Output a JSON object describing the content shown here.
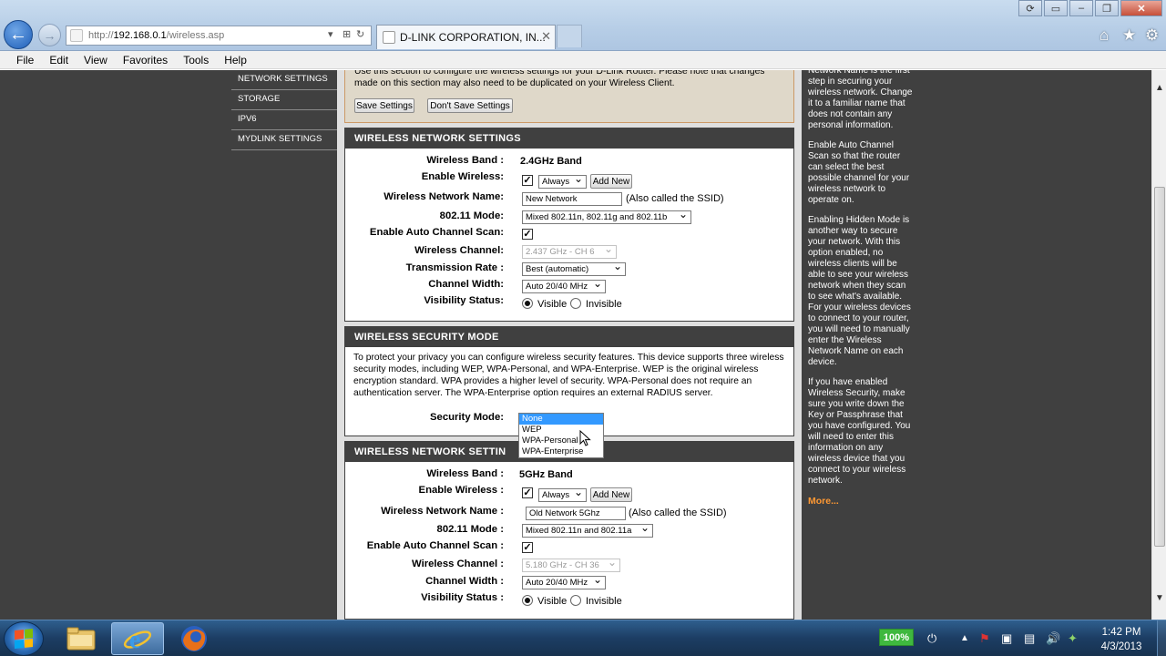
{
  "browser": {
    "url_scheme": "http://",
    "url_host": "192.168.0.1",
    "url_path": "/wireless.asp",
    "tab_title": "D-LINK CORPORATION, IN...",
    "menu": [
      "File",
      "Edit",
      "View",
      "Favorites",
      "Tools",
      "Help"
    ]
  },
  "leftnav": {
    "items": [
      "NETWORK SETTINGS",
      "STORAGE",
      "IPV6",
      "MYDLINK SETTINGS"
    ]
  },
  "intro": {
    "text": "Use this section to configure the wireless settings for your D-Link Router. Please note that changes made on this section may also need to be duplicated on your Wireless Client.",
    "save_label": "Save Settings",
    "dont_save_label": "Don't Save Settings"
  },
  "wns1": {
    "heading": "WIRELESS NETWORK SETTINGS",
    "band_label": "Wireless Band :",
    "band_value": "2.4GHz Band",
    "enable_label": "Enable Wireless:",
    "enable_checked": true,
    "schedule_value": "Always",
    "add_new_label": "Add New",
    "name_label": "Wireless Network Name:",
    "name_value": "New Network",
    "ssid_hint": "(Also called the SSID)",
    "mode_label": "802.11 Mode:",
    "mode_value": "Mixed 802.11n, 802.11g and 802.11b",
    "auto_scan_label": "Enable Auto Channel Scan:",
    "auto_scan_checked": true,
    "channel_label": "Wireless Channel:",
    "channel_value": "2.437 GHz - CH 6",
    "rate_label": "Transmission Rate :",
    "rate_value": "Best (automatic)",
    "width_label": "Channel Width:",
    "width_value": "Auto 20/40 MHz",
    "visibility_label": "Visibility Status:",
    "visible_label": "Visible",
    "invisible_label": "Invisible",
    "visibility_selected": "Visible"
  },
  "security": {
    "heading": "WIRELESS SECURITY MODE",
    "description": "To protect your privacy you can configure wireless security features. This device supports three wireless security modes, including WEP, WPA-Personal, and WPA-Enterprise. WEP is the original wireless encryption standard. WPA provides a higher level of security. WPA-Personal does not require an authentication server. The WPA-Enterprise option requires an external RADIUS server.",
    "mode_label": "Security Mode:",
    "options": [
      "None",
      "WEP",
      "WPA-Personal",
      "WPA-Enterprise"
    ],
    "selected": "None"
  },
  "wns2": {
    "heading": "WIRELESS NETWORK SETTIN",
    "band_label": "Wireless Band :",
    "band_value": "5GHz Band",
    "enable_label": "Enable Wireless :",
    "enable_checked": true,
    "schedule_value": "Always",
    "add_new_label": "Add New",
    "name_label": "Wireless Network Name :",
    "name_value": "Old Network 5Ghz",
    "ssid_hint": "(Also called the SSID)",
    "mode_label": "802.11 Mode :",
    "mode_value": "Mixed 802.11n and 802.11a",
    "auto_scan_label": "Enable Auto Channel Scan :",
    "auto_scan_checked": true,
    "channel_label": "Wireless Channel :",
    "channel_value": "5.180 GHz - CH 36",
    "width_label": "Channel Width :",
    "width_value": "Auto 20/40 MHz",
    "visibility_label": "Visibility Status :",
    "visible_label": "Visible",
    "invisible_label": "Invisible",
    "visibility_selected": "Visible"
  },
  "help": {
    "p1": "Network Name is the first step in securing your wireless network. Change it to a familiar name that does not contain any personal information.",
    "p2": "Enable Auto Channel Scan so that the router can select the best possible channel for your wireless network to operate on.",
    "p3": "Enabling Hidden Mode is another way to secure your network. With this option enabled, no wireless clients will be able to see your wireless network when they scan to see what's available. For your wireless devices to connect to your router, you will need to manually enter the Wireless Network Name on each device.",
    "p4": "If you have enabled Wireless Security, make sure you write down the Key or Passphrase that you have configured. You will need to enter this information on any wireless device that you connect to your wireless network.",
    "more": "More..."
  },
  "taskbar": {
    "battery": "100%",
    "time": "1:42 PM",
    "date": "4/3/2013"
  }
}
